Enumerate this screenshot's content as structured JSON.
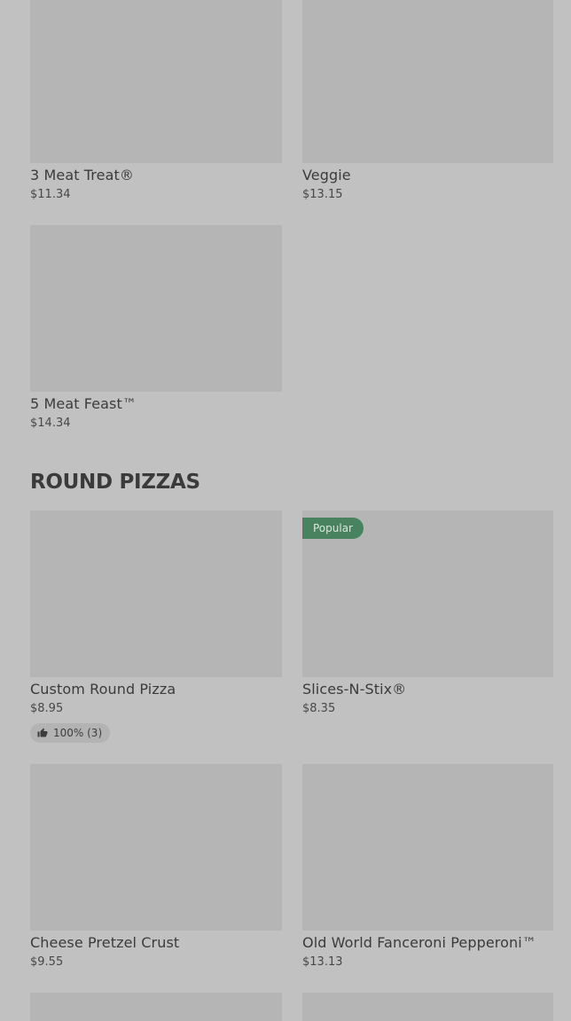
{
  "colors": {
    "background": "#c1c1c1",
    "image_placeholder": "#b5b5b5",
    "popular_badge": "#48825e",
    "text": "#3a3a3a"
  },
  "top_items": [
    {
      "name": "3 Meat Treat®",
      "price": "$11.34"
    },
    {
      "name": "Veggie",
      "price": "$13.15"
    },
    {
      "name": "5 Meat Feast™",
      "price": "$14.34"
    }
  ],
  "round_pizzas": {
    "title": "ROUND PIZZAS",
    "items": [
      {
        "name": "Custom Round Pizza",
        "price": "$8.95",
        "rating": {
          "icon": "thumbs-up-icon",
          "text": "100% (3)"
        }
      },
      {
        "name": "Slices-N-Stix®",
        "price": "$8.35",
        "badge": "Popular"
      },
      {
        "name": "Cheese Pretzel Crust",
        "price": "$9.55"
      },
      {
        "name": "Old World Fanceroni Pepperoni™",
        "price": "$13.13"
      }
    ]
  }
}
